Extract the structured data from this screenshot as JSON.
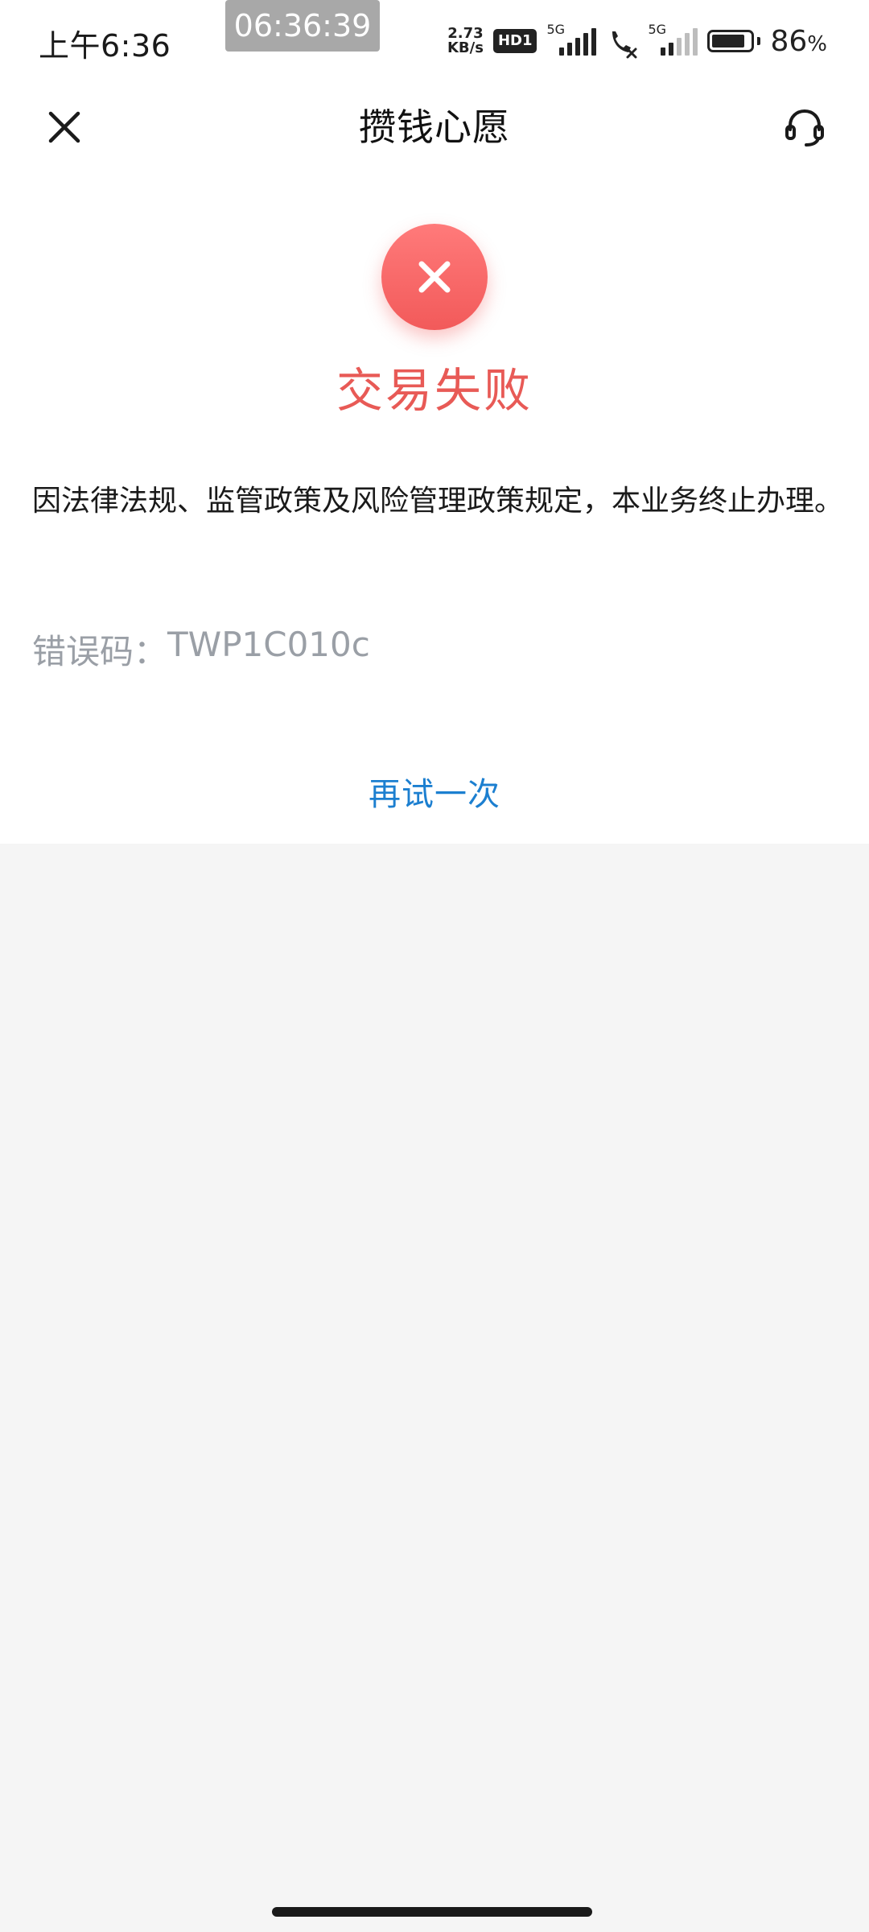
{
  "status_bar": {
    "time": "上午6:36",
    "clock_overlay": "06:36:39",
    "net_speed_value": "2.73",
    "net_speed_unit": "KB/s",
    "hd_badge": "HD1",
    "sim1_tag": "5G",
    "sim2_tag": "5G",
    "battery_value": "86",
    "battery_unit": "%",
    "battery_level": 0.86
  },
  "nav": {
    "title": "攒钱心愿",
    "close_icon": "close-icon",
    "service_icon": "headset-icon"
  },
  "result": {
    "status_icon": "error-x-icon",
    "title": "交易失败",
    "message": "因法律法规、监管政策及风险管理政策规定，本业务终止办理。",
    "error_code_label": "错误码：",
    "error_code_value": "TWP1C010c",
    "retry_label": "再试一次"
  },
  "colors": {
    "error_accent": "#e85a56",
    "link_blue": "#1c7fd0",
    "muted_gray": "#9a9fa6",
    "page_background": "#f5f5f5"
  }
}
